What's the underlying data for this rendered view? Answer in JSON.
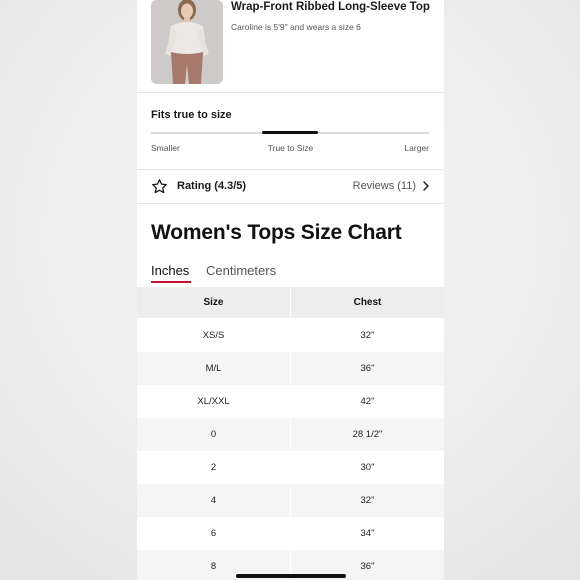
{
  "product": {
    "title": "Wrap-Front Ribbed Long-Sleeve Top",
    "model_note": "Caroline is 5'9\" and wears a size 6"
  },
  "fit": {
    "title": "Fits true to size",
    "labels": [
      "Smaller",
      "True to Size",
      "Larger"
    ],
    "position": 0.5
  },
  "rating": {
    "label": "Rating (4.3/5)",
    "reviews": "Reviews (11)",
    "icon": "star-outline-icon",
    "chevron_icon": "chevron-right-icon"
  },
  "size_chart": {
    "title": "Women's Tops Size Chart",
    "tabs": [
      {
        "label": "Inches",
        "active": true
      },
      {
        "label": "Centimeters",
        "active": false
      }
    ],
    "columns": [
      "Size",
      "Chest"
    ],
    "rows": [
      [
        "XS/S",
        "32\""
      ],
      [
        "M/L",
        "36\""
      ],
      [
        "XL/XXL",
        "42\""
      ],
      [
        "0",
        "28 1/2\""
      ],
      [
        "2",
        "30\""
      ],
      [
        "4",
        "32\""
      ],
      [
        "6",
        "34\""
      ],
      [
        "8",
        "36\""
      ]
    ]
  },
  "colors": {
    "accent_underline": "#c8102e",
    "header_bg": "#ededed",
    "zebra_bg": "#f5f5f5"
  }
}
